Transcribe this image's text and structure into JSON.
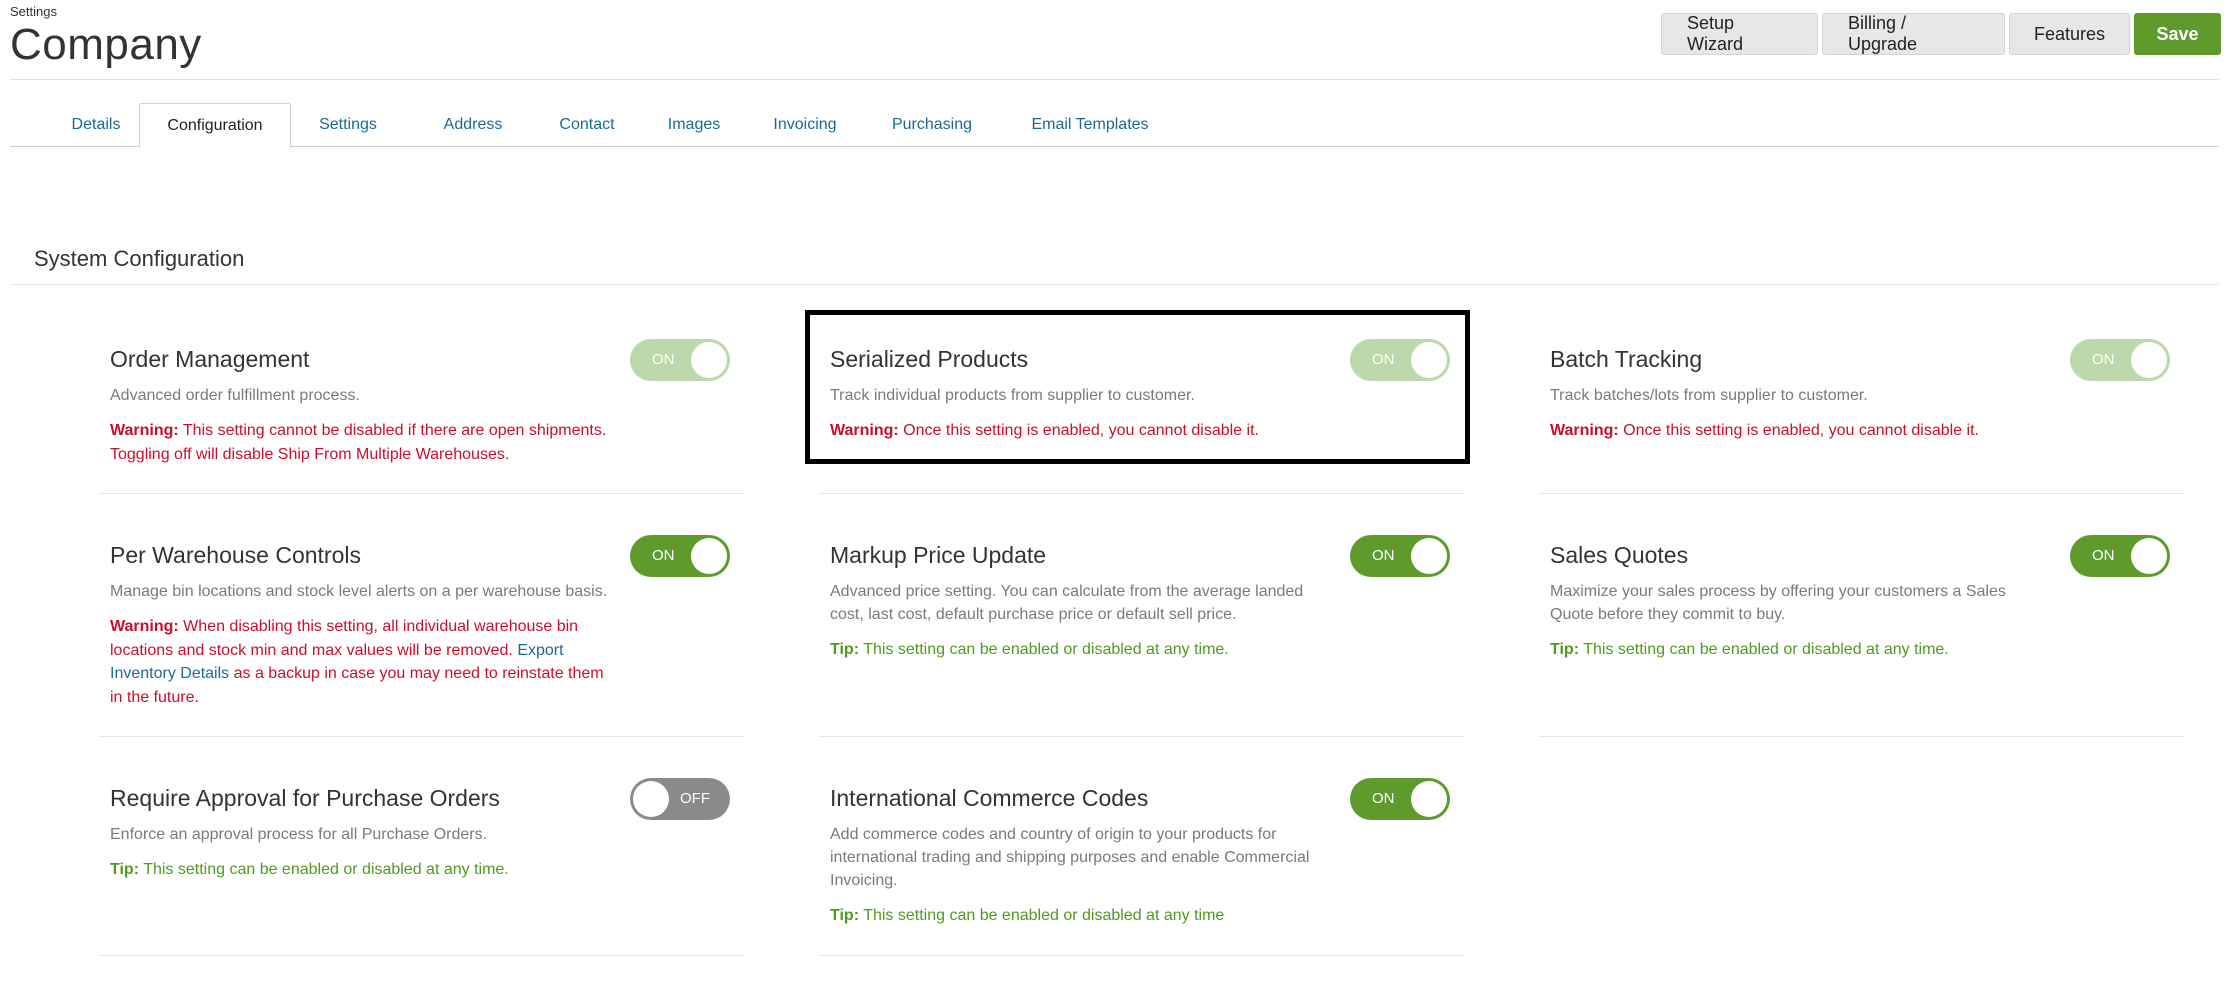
{
  "header": {
    "breadcrumb": "Settings",
    "title": "Company",
    "actions": {
      "setup_wizard": "Setup Wizard",
      "billing": "Billing / Upgrade",
      "features": "Features",
      "save": "Save"
    }
  },
  "tabs": [
    {
      "label": "Details",
      "active": false
    },
    {
      "label": "Configuration",
      "active": true
    },
    {
      "label": "Settings",
      "active": false
    },
    {
      "label": "Address",
      "active": false
    },
    {
      "label": "Contact",
      "active": false
    },
    {
      "label": "Images",
      "active": false
    },
    {
      "label": "Invoicing",
      "active": false
    },
    {
      "label": "Purchasing",
      "active": false
    },
    {
      "label": "Email Templates",
      "active": false
    }
  ],
  "section": {
    "title": "System Configuration"
  },
  "cards": {
    "order_management": {
      "title": "Order Management",
      "description": "Advanced order fulfillment process.",
      "note_label": "Warning:",
      "note_text": " This setting cannot be disabled if there are open shipments. Toggling off will disable Ship From Multiple Warehouses.",
      "toggle": "ON"
    },
    "serialized_products": {
      "title": "Serialized Products",
      "description": "Track individual products from supplier to customer.",
      "note_label": "Warning:",
      "note_text": " Once this setting is enabled, you cannot disable it.",
      "toggle": "ON"
    },
    "batch_tracking": {
      "title": "Batch Tracking",
      "description": "Track batches/lots from supplier to customer.",
      "note_label": "Warning:",
      "note_text": " Once this setting is enabled, you cannot disable it.",
      "toggle": "ON"
    },
    "per_warehouse_controls": {
      "title": "Per Warehouse Controls",
      "description": "Manage bin locations and stock level alerts on a per warehouse basis.",
      "note_label": "Warning:",
      "note_text_before": " When disabling this setting, all individual warehouse bin locations and stock min and max values will be removed. ",
      "note_link": "Export Inventory Details",
      "note_text_after": " as a backup in case you may need to reinstate them in the future.",
      "toggle": "ON"
    },
    "markup_price_update": {
      "title": "Markup Price Update",
      "description": "Advanced price setting. You can calculate from the average landed cost, last cost, default purchase price or default sell price.",
      "note_label": "Tip:",
      "note_text": " This setting can be enabled or disabled at any time.",
      "toggle": "ON"
    },
    "sales_quotes": {
      "title": "Sales Quotes",
      "description": "Maximize your sales process by offering your customers a Sales Quote before they commit to buy.",
      "note_label": "Tip:",
      "note_text": " This setting can be enabled or disabled at any time.",
      "toggle": "ON"
    },
    "require_approval": {
      "title": "Require Approval for Purchase Orders",
      "description": "Enforce an approval process for all Purchase Orders.",
      "note_label": "Tip:",
      "note_text": " This setting can be enabled or disabled at any time.",
      "toggle": "OFF"
    },
    "international_commerce": {
      "title": "International Commerce Codes",
      "description": "Add commerce codes and country of origin to your products for international trading and shipping purposes and enable Commercial Invoicing.",
      "note_label": "Tip:",
      "note_text": " This setting can be enabled or disabled at any time",
      "toggle": "ON"
    }
  }
}
